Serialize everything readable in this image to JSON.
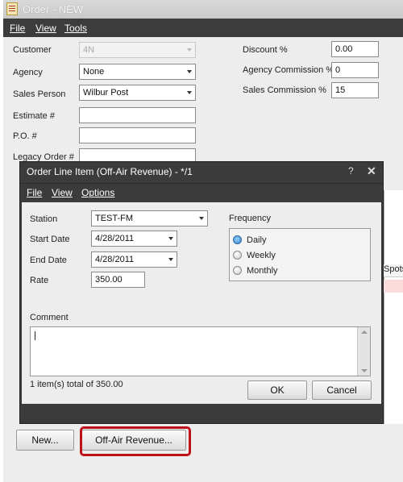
{
  "main": {
    "title": "Order - NEW",
    "menu": {
      "file": "File",
      "view": "View",
      "tools": "Tools"
    },
    "fields": {
      "customer_label": "Customer",
      "customer_value": "4N",
      "agency_label": "Agency",
      "agency_value": "None",
      "sales_person_label": "Sales Person",
      "sales_person_value": "Wilbur Post",
      "estimate_label": "Estimate #",
      "estimate_value": "",
      "po_label": "P.O. #",
      "po_value": "",
      "legacy_order_label": "Legacy Order #",
      "legacy_order_value": "",
      "discount_label": "Discount %",
      "discount_value": "0.00",
      "agency_commission_label": "Agency Commission %",
      "agency_commission_value": "0",
      "sales_commission_label": "Sales Commission %",
      "sales_commission_value": "15"
    },
    "grid": {
      "spots_header": "Spots"
    },
    "buttons": {
      "new": "New...",
      "off_air_revenue": "Off-Air Revenue..."
    }
  },
  "dialog": {
    "title": "Order Line Item (Off-Air Revenue) - */1",
    "help_glyph": "?",
    "close_glyph": "✕",
    "menu": {
      "file": "File",
      "view": "View",
      "options": "Options"
    },
    "station_label": "Station",
    "station_value": "TEST-FM",
    "start_date_label": "Start Date",
    "start_date_value": "4/28/2011",
    "end_date_label": "End Date",
    "end_date_value": "4/28/2011",
    "rate_label": "Rate",
    "rate_value": "350.00",
    "frequency_label": "Frequency",
    "frequency_options": [
      "Daily",
      "Weekly",
      "Monthly"
    ],
    "frequency_selected": "Daily",
    "comment_label": "Comment",
    "comment_value": "",
    "summary": "1 item(s) total of 350.00",
    "ok_label": "OK",
    "cancel_label": "Cancel"
  },
  "colors": {
    "highlight": "#c0101a",
    "dark_chrome": "#3b3b3b",
    "selected_radio": "#2f7ec9"
  }
}
